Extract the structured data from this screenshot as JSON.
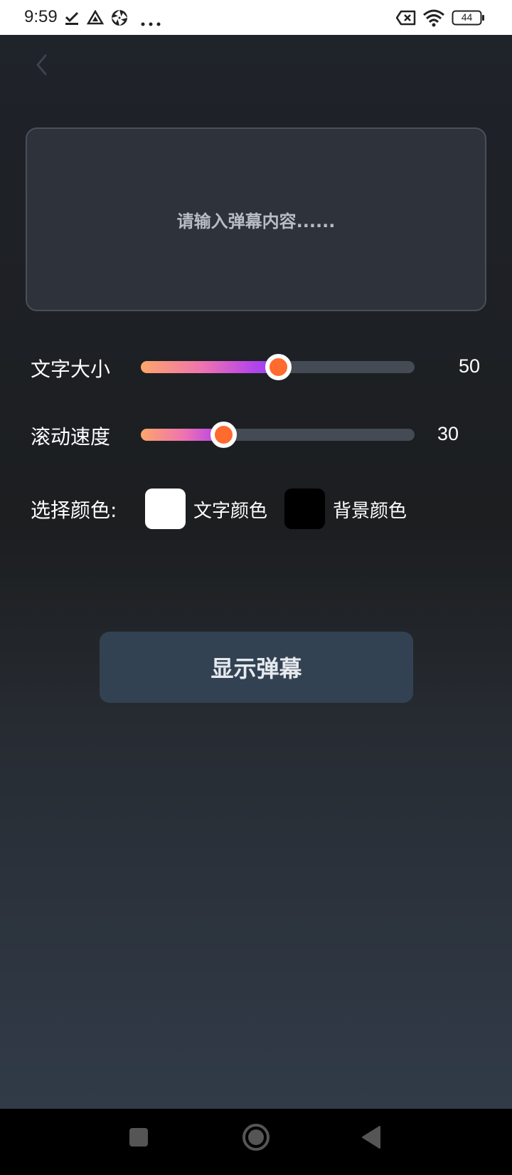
{
  "status_bar": {
    "time": "9:59",
    "battery": "44",
    "icons": [
      "download-done-icon",
      "drive-icon",
      "aperture-icon",
      "more-dots-icon",
      "no-sim-icon",
      "wifi-icon",
      "battery-icon"
    ]
  },
  "header": {
    "back_icon": "chevron-left-icon"
  },
  "input": {
    "placeholder": "请输入弹幕内容......"
  },
  "font_size": {
    "label": "文字大小",
    "value": "50",
    "level": 0.5
  },
  "scroll_speed": {
    "label": "滚动速度",
    "value": "30",
    "level": 0.3
  },
  "colors": {
    "label": "选择颜色:",
    "text_color_label": "文字颜色",
    "text_color": "#ffffff",
    "background_color_label": "背景颜色",
    "background_color": "#000000"
  },
  "show_button": {
    "label": "显示弹幕"
  },
  "nav_bar": {
    "icons": [
      "recents-square-icon",
      "home-circle-icon",
      "back-triangle-icon"
    ]
  },
  "accent": {
    "thumb": "#ff6a2f",
    "gradient_start": "#fda66a",
    "gradient_end": "#8d44f0"
  }
}
